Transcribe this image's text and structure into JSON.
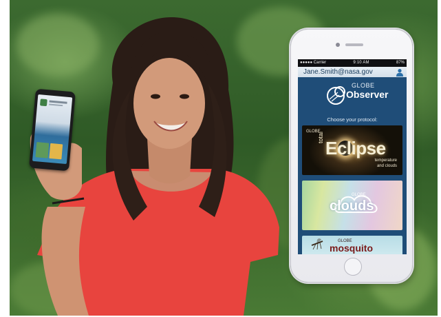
{
  "scene": {
    "description_icons": [
      "woman-icon",
      "small-phone-icon"
    ]
  },
  "phone": {
    "status": {
      "carrier": "●●●●● Carrier",
      "time": "9:10 AM",
      "battery": "87%"
    },
    "account_email": "Jane.Smith@nasa.gov",
    "app": {
      "globe_word": "GLOBE",
      "observer_word": "Observer",
      "choose_prompt": "Choose your protocol:"
    },
    "protocols": [
      {
        "globe": "GLOBE",
        "total": "total",
        "title": "Eclipse",
        "sub1": "temperature",
        "sub2": "and clouds"
      },
      {
        "globe": "GLOBE",
        "title": "clouds"
      },
      {
        "globe": "GLOBE",
        "title": "mosquito"
      }
    ]
  },
  "colors": {
    "app_background": "#1f4d78",
    "shirt": "#e8443e"
  }
}
